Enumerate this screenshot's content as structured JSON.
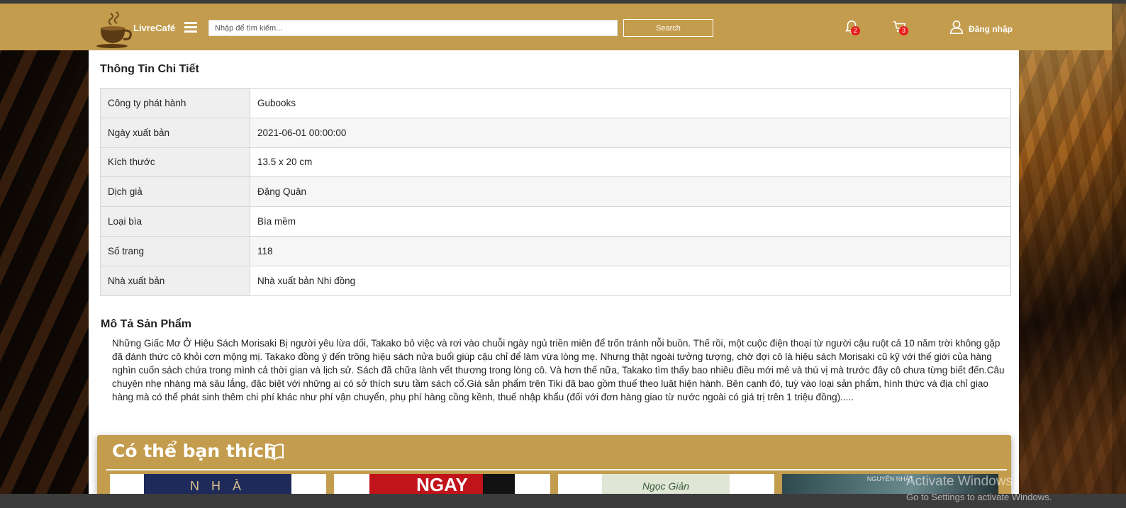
{
  "header": {
    "brand": "LivreCafé",
    "search_placeholder": "Nhập để tìm kiếm...",
    "search_button": "Search",
    "notification_count": "2",
    "cart_count": "3",
    "login_label": "Đăng nhập"
  },
  "details": {
    "title": "Thông Tin Chi Tiết",
    "rows": [
      {
        "key": "Công ty phát hành",
        "value": "Gubooks"
      },
      {
        "key": "Ngày xuất bản",
        "value": "2021-06-01 00:00:00"
      },
      {
        "key": "Kích thước",
        "value": "13.5 x 20 cm"
      },
      {
        "key": "Dịch giả",
        "value": "Đặng Quân"
      },
      {
        "key": "Loại bìa",
        "value": "Bìa mềm"
      },
      {
        "key": "Số trang",
        "value": "118"
      },
      {
        "key": "Nhà xuất bản",
        "value": "Nhà xuất bản Nhi đồng"
      }
    ]
  },
  "description": {
    "title": "Mô Tả Sản Phẩm",
    "text": "Những Giấc Mơ Ở Hiệu Sách Morisaki Bị người yêu lừa dối, Takako bỏ việc và rơi vào chuỗi ngày ngủ triền miên để trốn tránh nỗi buồn. Thế rồi, một cuộc điện thoại từ người cậu ruột cả 10 năm trời không gặp đã đánh thức cô khỏi cơn mộng mị. Takako đồng ý đến trông hiệu sách nửa buổi giúp cậu chỉ để làm vừa lòng mẹ. Nhưng thật ngoài tưởng tượng, chờ đợi cô là hiệu sách Morisaki cũ kỹ với thế giới của hàng nghìn cuốn sách chứa trong mình cả thời gian và lịch sử. Sách đã chữa lành vết thương trong lòng cô. Và hơn thế nữa, Takako tìm thấy bao nhiêu điều mới mẻ và thú vị mà trước đây cô chưa từng biết đến.Câu chuyện nhẹ nhàng mà sâu lắng, đặc biệt với những ai có sở thích sưu tầm sách cổ.Giá sản phẩm trên Tiki đã bao gồm thuế theo luật hiện hành. Bên cạnh đó, tuỳ vào loại sản phẩm, hình thức và địa chỉ giao hàng mà có thể phát sinh thêm chi phí khác như phí vận chuyển, phụ phí hàng cồng kềnh, thuế nhập khẩu (đối với đơn hàng giao từ nước ngoài có giá trị trên 1 triệu đồng)....."
  },
  "suggestions": {
    "title": "Có thể bạn thích",
    "covers": [
      {
        "text": "N H À",
        "bg": "#1e2a5a"
      },
      {
        "text": "NGAY",
        "bg": "#c0141a"
      },
      {
        "text": "Ngọc Giản",
        "bg": "#dfe6d5"
      },
      {
        "text": "NGUYÊN NHẬT",
        "bg": "#2e4a4e"
      }
    ]
  },
  "watermark": {
    "line1": "Activate Windows",
    "line2": "Go to Settings to activate Windows."
  },
  "colors": {
    "header_bg": "#c39c4d",
    "badge": "#e81c1c"
  }
}
